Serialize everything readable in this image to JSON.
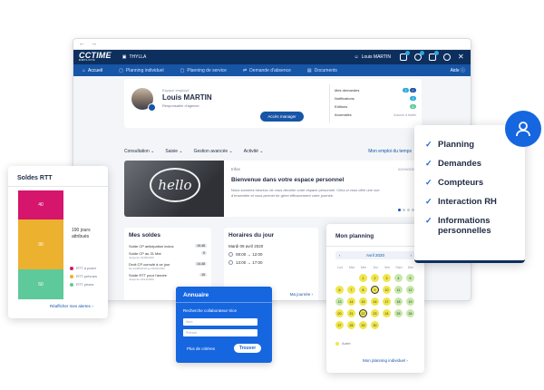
{
  "header": {
    "logo": "CCTIME",
    "logo_sub": "EMPLOYÉ",
    "company": "THYLLA",
    "user": "Louis MARTIN",
    "aide": "Aide"
  },
  "menu": [
    "Accueil",
    "Planning individuel",
    "Planning de service",
    "Demande d'absence",
    "Documents"
  ],
  "profile": {
    "label": "Espace employé",
    "name": "Louis MARTIN",
    "role": "Responsable d'agence",
    "button": "Accès manager",
    "stats": [
      {
        "label": "Mes demandes",
        "values": [
          "2",
          "0"
        ]
      },
      {
        "label": "Notifications",
        "values": [
          "3"
        ]
      },
      {
        "label": "Editions",
        "values": [
          "8"
        ]
      },
      {
        "label": "Anomalies",
        "note": "Aucune à traiter"
      }
    ]
  },
  "subnav": {
    "items": [
      "Consultation",
      "Saisie",
      "Gestion avancée",
      "Activité"
    ],
    "link": "Mon emploi du temps"
  },
  "info": {
    "label": "Infos",
    "date": "02/04/2020",
    "title": "Bienvenue dans votre espace personnel",
    "text": "Nous sommes heureux de vous dévoiler votre espace personnel. Celui-ci vous offre une vue d'ensemble et vous permet de gérer efficacement votre journée.",
    "image_text": "hello"
  },
  "soldes": {
    "title": "Mes soldes",
    "rows": [
      {
        "label": "Solde CP anticipation inclus",
        "value": "19.48"
      },
      {
        "label": "Solde CP au 31 Mai",
        "sub": "Jusqu'au 31/05/2020",
        "value": "5"
      },
      {
        "label": "Droit CP cumulé à ce jour",
        "sub": "Du 01/06/2019 au 09/04/2020",
        "value": "14.48"
      },
      {
        "label": "Solde RTT pour l'année",
        "sub": "Jusqu'au 31/12/2020",
        "value": "15"
      }
    ]
  },
  "horaires": {
    "title": "Horaires du jour",
    "date": "Mardi 09 avril 2020",
    "slots": [
      "08:00 → 12:00",
      "13:00 → 17:00"
    ],
    "link": "Ma journée"
  },
  "rtt": {
    "title": "Soldes RTT",
    "bars": [
      {
        "value": "40",
        "color": "#d6156d"
      },
      {
        "value": "90",
        "color": "#ecb12e"
      },
      {
        "value": "60",
        "color": "#5ec99a"
      }
    ],
    "total_line1": "190 jours",
    "total_line2": "attribués",
    "legend": [
      {
        "label": "RTT à poser",
        "color": "#d6156d"
      },
      {
        "label": "RTT prévues",
        "color": "#ecb12e"
      },
      {
        "label": "RTT prises",
        "color": "#5ec99a"
      }
    ],
    "link": "Réafficher mes alertes"
  },
  "annuaire": {
    "title": "Annuaire",
    "label": "Recherche collaborateur·trice",
    "nom_placeholder": "Nom",
    "prenom_placeholder": "Prénom",
    "criteria": "Plus de critères",
    "button": "Trouver"
  },
  "planning": {
    "title": "Mon planning",
    "month": "Avril 2020",
    "weekdays": [
      "Lun",
      "Mar",
      "Mer",
      "Jeu",
      "Ven",
      "Sam",
      "Dim"
    ],
    "legend": "Autre",
    "link": "Mon planning individuel"
  },
  "features": [
    "Planning",
    "Demandes",
    "Compteurs",
    "Interaction RH",
    "Informations personnelles"
  ]
}
